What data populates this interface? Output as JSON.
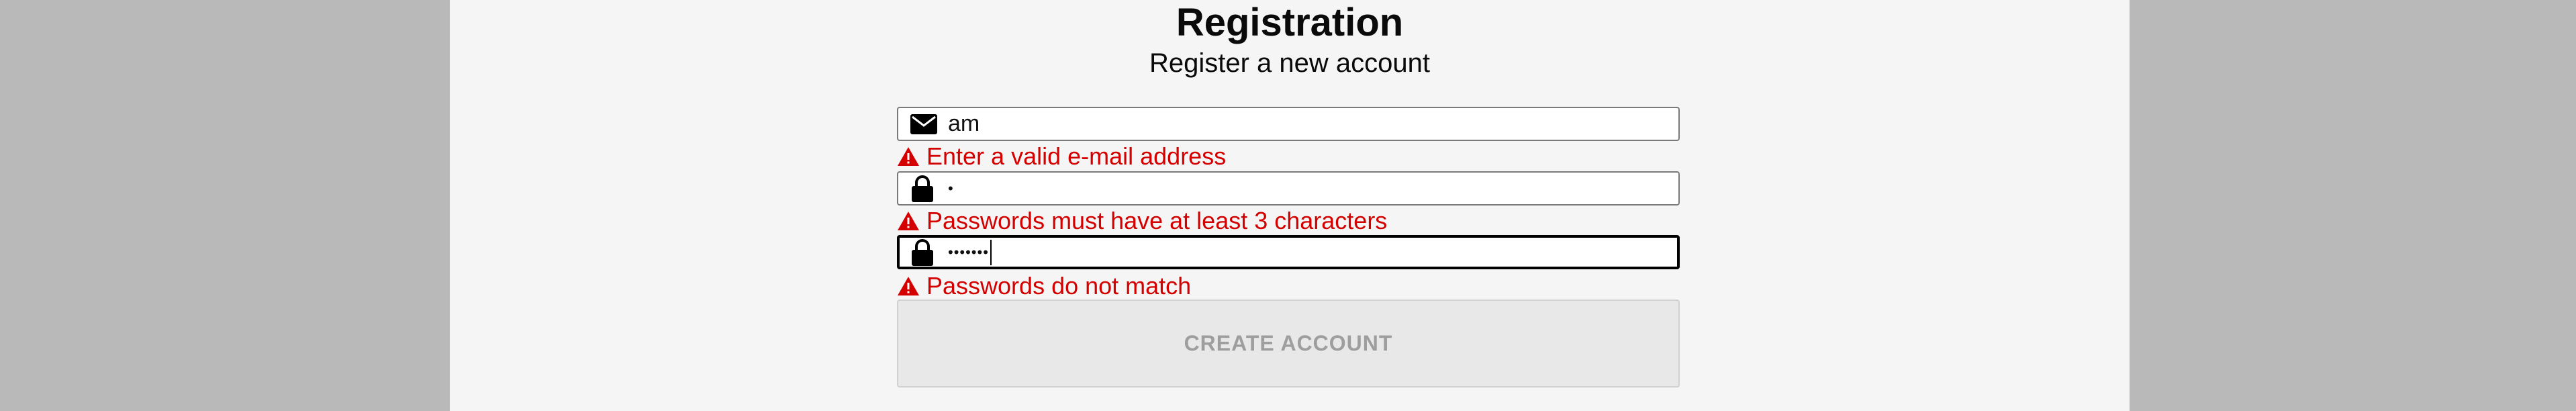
{
  "form": {
    "title": "Registration",
    "subtitle": "Register a new account",
    "email": {
      "value": "am",
      "icon": "envelope-icon",
      "error": "Enter a valid e-mail address"
    },
    "password": {
      "masked_value": "•",
      "icon": "lock-icon",
      "error": "Passwords must have at least 3 characters"
    },
    "confirm_password": {
      "masked_value": "•••••••",
      "icon": "lock-icon",
      "error": "Passwords do not match"
    },
    "submit_label": "CREATE ACCOUNT"
  },
  "colors": {
    "background": "#b9b9b9",
    "panel": "#f5f5f5",
    "error": "#d40000",
    "button_disabled_bg": "#e8e8e8",
    "button_disabled_text": "#9e9e9e"
  }
}
